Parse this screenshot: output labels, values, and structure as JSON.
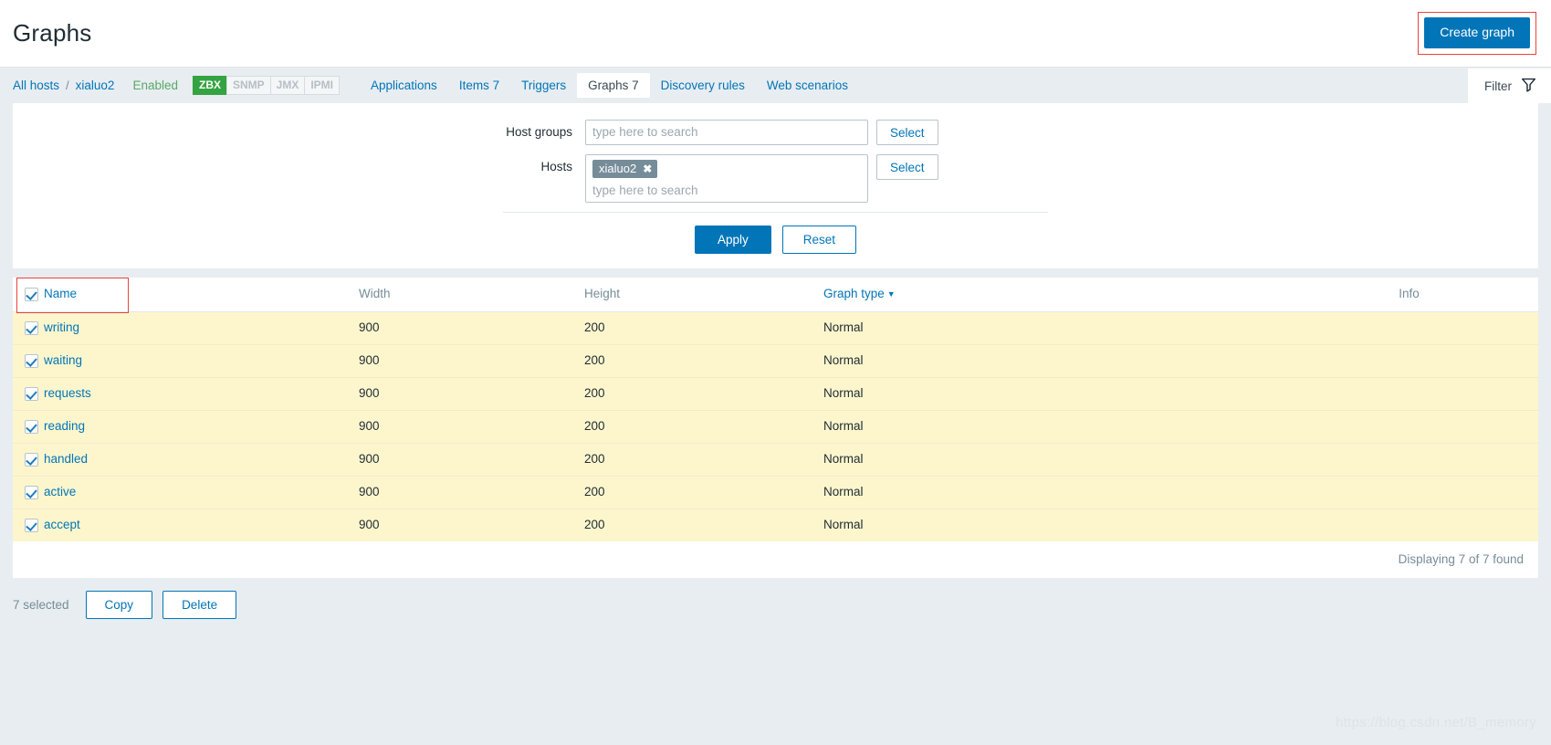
{
  "header": {
    "title": "Graphs",
    "create_button": "Create graph"
  },
  "objectnav": {
    "all_hosts": "All hosts",
    "separator": "/",
    "host": "xialuo2",
    "status": "Enabled",
    "badges": [
      {
        "label": "ZBX",
        "active": true
      },
      {
        "label": "SNMP",
        "active": false
      },
      {
        "label": "JMX",
        "active": false
      },
      {
        "label": "IPMI",
        "active": false
      }
    ],
    "tabs": [
      {
        "label": "Applications",
        "active": false
      },
      {
        "label": "Items 7",
        "active": false
      },
      {
        "label": "Triggers",
        "active": false
      },
      {
        "label": "Graphs 7",
        "active": true
      },
      {
        "label": "Discovery rules",
        "active": false
      },
      {
        "label": "Web scenarios",
        "active": false
      }
    ],
    "filter_tab": "Filter",
    "filter_icon": "funnel-icon"
  },
  "filter": {
    "host_groups": {
      "label": "Host groups",
      "value": "",
      "placeholder": "type here to search",
      "select_button": "Select"
    },
    "hosts": {
      "label": "Hosts",
      "chips": [
        "xialuo2"
      ],
      "chip_remove_icon": "close-icon",
      "value": "",
      "placeholder": "type here to search",
      "select_button": "Select"
    },
    "apply_button": "Apply",
    "reset_button": "Reset"
  },
  "table": {
    "columns": [
      {
        "key": "name",
        "label": "Name",
        "sortable": true
      },
      {
        "key": "width",
        "label": "Width",
        "sortable": false
      },
      {
        "key": "height",
        "label": "Height",
        "sortable": false
      },
      {
        "key": "graph_type",
        "label": "Graph type",
        "sortable": true,
        "sort_dir": "▼"
      },
      {
        "key": "info",
        "label": "Info",
        "sortable": false
      }
    ],
    "select_all_checked": true,
    "rows": [
      {
        "checked": true,
        "name": "writing",
        "width": "900",
        "height": "200",
        "graph_type": "Normal",
        "info": ""
      },
      {
        "checked": true,
        "name": "waiting",
        "width": "900",
        "height": "200",
        "graph_type": "Normal",
        "info": ""
      },
      {
        "checked": true,
        "name": "requests",
        "width": "900",
        "height": "200",
        "graph_type": "Normal",
        "info": ""
      },
      {
        "checked": true,
        "name": "reading",
        "width": "900",
        "height": "200",
        "graph_type": "Normal",
        "info": ""
      },
      {
        "checked": true,
        "name": "handled",
        "width": "900",
        "height": "200",
        "graph_type": "Normal",
        "info": ""
      },
      {
        "checked": true,
        "name": "active",
        "width": "900",
        "height": "200",
        "graph_type": "Normal",
        "info": ""
      },
      {
        "checked": true,
        "name": "accept",
        "width": "900",
        "height": "200",
        "graph_type": "Normal",
        "info": ""
      }
    ],
    "footer_text": "Displaying 7 of 7 found"
  },
  "bottom": {
    "selected_text": "7 selected",
    "copy_button": "Copy",
    "delete_button": "Delete"
  },
  "watermark": "https://blog.csdn.net/B_memory",
  "colors": {
    "accent": "#0275b8",
    "enabled": "#59a869",
    "zbx_badge": "#34a341",
    "row_selected": "#fdf6cd",
    "highlight_box": "#e8443a",
    "page_bg": "#e8edf1"
  }
}
